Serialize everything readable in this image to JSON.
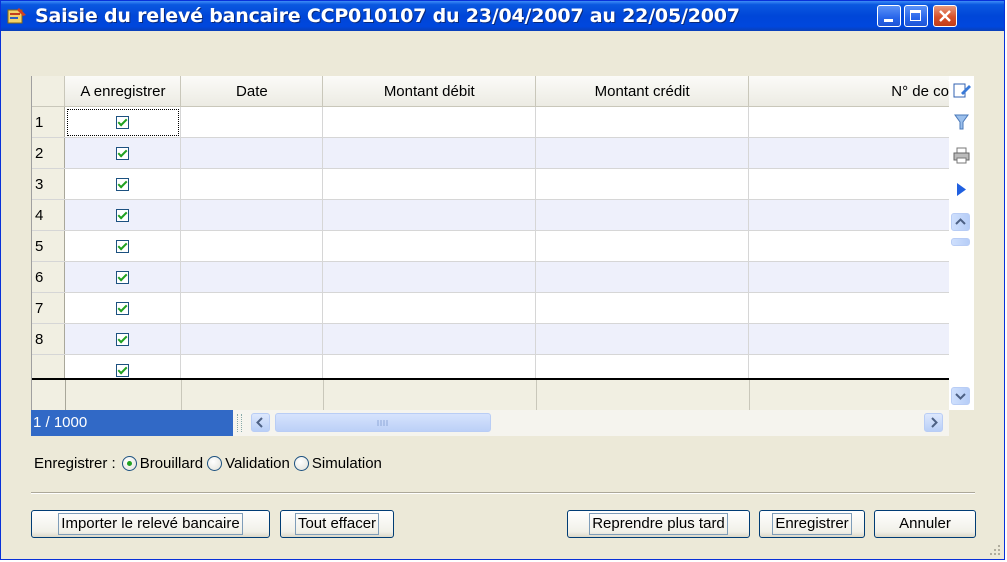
{
  "window": {
    "title": "Saisie du relevé bancaire CCP010107 du 23/04/2007 au 22/05/2007",
    "colors": {
      "titlebar": "#0046d8",
      "close": "#d8502a",
      "selection": "#3169c6",
      "check": "#21a121"
    }
  },
  "grid": {
    "columns": [
      "A enregistrer",
      "Date",
      "Montant débit",
      "Montant crédit",
      "N° de co"
    ],
    "rows": [
      {
        "num": "1",
        "checked": true
      },
      {
        "num": "2",
        "checked": true
      },
      {
        "num": "3",
        "checked": true
      },
      {
        "num": "4",
        "checked": true
      },
      {
        "num": "5",
        "checked": true
      },
      {
        "num": "6",
        "checked": true
      },
      {
        "num": "7",
        "checked": true
      },
      {
        "num": "8",
        "checked": true
      }
    ],
    "pager": "1 / 1000",
    "side_icons": [
      "edit-icon",
      "filter-icon",
      "print-icon",
      "next-icon"
    ]
  },
  "save_options": {
    "label": "Enregistrer :",
    "options": [
      "Brouillard",
      "Validation",
      "Simulation"
    ],
    "selected": "Brouillard"
  },
  "buttons": {
    "import": "Importer le relevé bancaire",
    "clear": "Tout effacer",
    "later": "Reprendre plus tard",
    "save": "Enregistrer",
    "cancel": "Annuler"
  }
}
